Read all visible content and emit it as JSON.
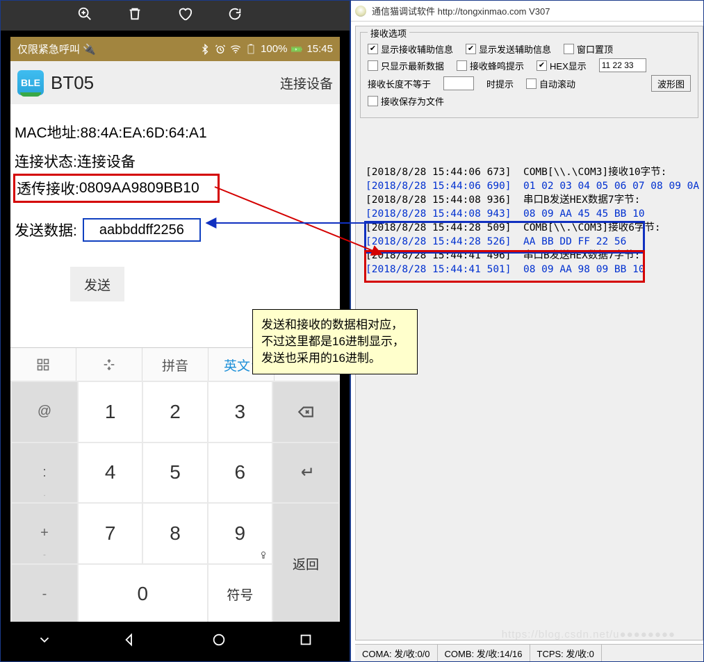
{
  "phone": {
    "status_left": "仅限紧急呼叫  🔌",
    "battery": "100%",
    "clock": "15:45",
    "app_title": "BT05",
    "app_action": "连接设备",
    "mac_line": "MAC地址:88:4A:EA:6D:64:A1",
    "conn_line": "连接状态:连接设备",
    "recv_label": "透传接收:",
    "recv_value": "0809AA9809BB10",
    "send_label": "发送数据:",
    "send_value": "aabbddff2256",
    "send_btn": "发送",
    "ime": {
      "pinyin": "拼音",
      "english": "英文"
    },
    "keys": {
      "at": "@",
      "colon": ":",
      "dot": ".",
      "plus": "+",
      "minus": "-",
      "k1": "1",
      "k2": "2",
      "k3": "3",
      "k4": "4",
      "k5": "5",
      "k6": "6",
      "k7": "7",
      "k8": "8",
      "k9": "9",
      "k0": "0",
      "symbol": "符号",
      "return": "返回"
    }
  },
  "win": {
    "title": "通信猫调试软件  http://tongxinmao.com  V307",
    "group_title": "接收选项",
    "opts": {
      "show_rx_aux": "显示接收辅助信息",
      "show_tx_aux": "显示发送辅助信息",
      "on_top": "窗口置顶",
      "only_latest": "只显示最新数据",
      "beep": "接收蜂鸣提示",
      "hex": "HEX显示",
      "hex_value": "11 22 33",
      "len_label": "接收长度不等于",
      "len_suffix": "时提示",
      "auto_scroll": "自动滚动",
      "wave_btn": "波形图",
      "save_file": "接收保存为文件"
    },
    "log": [
      {
        "c": "k",
        "t": "[2018/8/28 15:44:06 673]  COMB[\\\\.\\COM3]接收10字节:"
      },
      {
        "c": "b",
        "t": "[2018/8/28 15:44:06 690]  01 02 03 04 05 06 07 08 09 0A"
      },
      {
        "c": "k",
        "t": "[2018/8/28 15:44:08 936]  串口B发送HEX数据7字节:"
      },
      {
        "c": "b",
        "t": "[2018/8/28 15:44:08 943]  08 09 AA 45 45 BB 10"
      },
      {
        "c": "k",
        "t": "[2018/8/28 15:44:28 509]  COMB[\\\\.\\COM3]接收6字节:"
      },
      {
        "c": "b",
        "t": "[2018/8/28 15:44:28 526]  AA BB DD FF 22 56"
      },
      {
        "c": "k",
        "t": "[2018/8/28 15:44:41 496]  串口B发送HEX数据7字节:"
      },
      {
        "c": "b",
        "t": "[2018/8/28 15:44:41 501]  08 09 AA 98 09 BB 10"
      }
    ],
    "status": {
      "a": "COMA: 发/收:0/0",
      "b": "COMB: 发/收:14/16",
      "c": "TCPS: 发/收:0"
    }
  },
  "note": "发送和接收的数据相对应，不过这里都是16进制显示，发送也采用的16进制。"
}
